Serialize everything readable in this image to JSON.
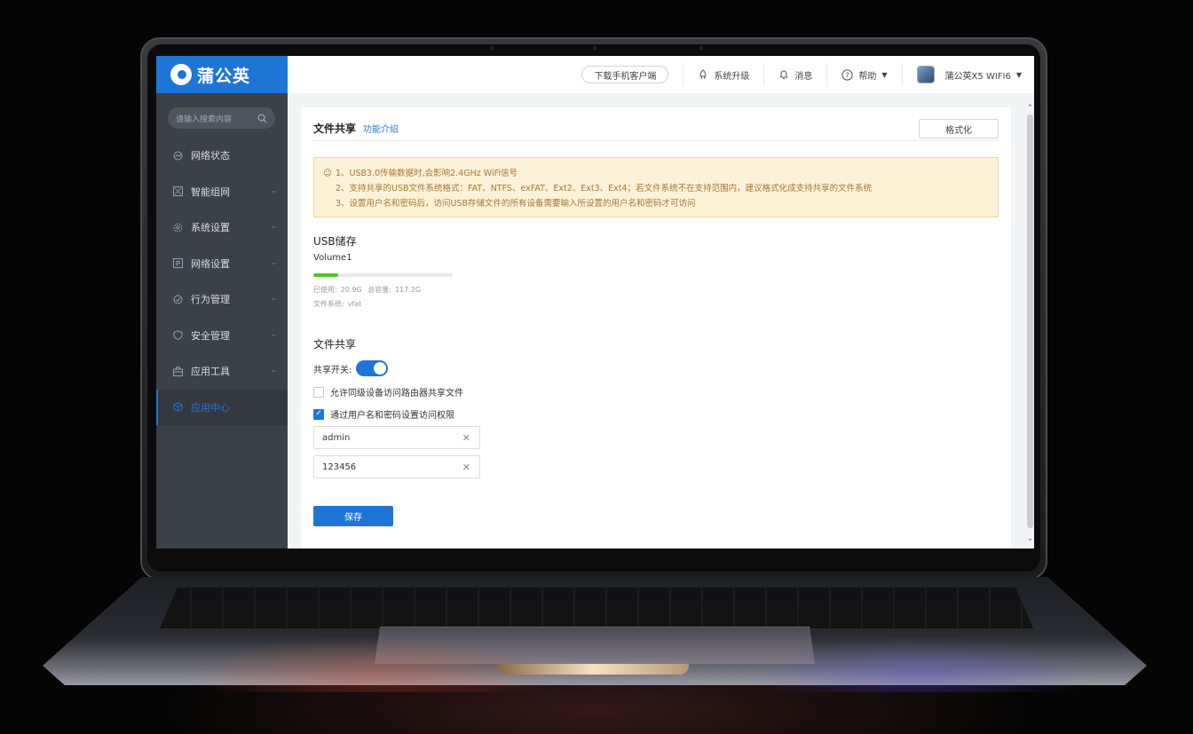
{
  "app": {
    "logo_text": "蒲公英"
  },
  "sidebar": {
    "search_placeholder": "请输入搜索内容",
    "items": [
      {
        "label": "网络状态",
        "icon": "network-status-icon",
        "has_arrow": false
      },
      {
        "label": "智能组网",
        "icon": "smart-network-icon",
        "has_arrow": true
      },
      {
        "label": "系统设置",
        "icon": "gear-icon",
        "has_arrow": true
      },
      {
        "label": "网络设置",
        "icon": "network-settings-icon",
        "has_arrow": true
      },
      {
        "label": "行为管理",
        "icon": "behavior-icon",
        "has_arrow": true
      },
      {
        "label": "安全管理",
        "icon": "shield-icon",
        "has_arrow": true
      },
      {
        "label": "应用工具",
        "icon": "toolbox-icon",
        "has_arrow": true
      },
      {
        "label": "应用中心",
        "icon": "cube-icon",
        "has_arrow": false,
        "active": true
      }
    ]
  },
  "topbar": {
    "download_label": "下载手机客户端",
    "upgrade_label": "系统升级",
    "messages_label": "消息",
    "help_label": "帮助",
    "device_label": "蒲公英X5 WIFI6"
  },
  "page": {
    "title": "文件共享",
    "intro_link": "功能介绍",
    "format_button": "格式化",
    "notices": [
      "1、USB3.0传输数据时,会影响2.4GHz WiFi信号",
      "2、支持共享的USB文件系统格式：FAT、NTFS、exFAT、Ext2、Ext3、Ext4；若文件系统不在支持范围内，建议格式化成支持共享的文件系统",
      "3、设置用户名和密码后，访问USB存储文件的所有设备需要输入所设置的用户名和密码才可访问"
    ],
    "usb_section_title": "USB储存",
    "volume": {
      "name": "Volume1",
      "used_label": "已使用:",
      "used_value": "20.9G",
      "total_label": "总容量:",
      "total_value": "117.2G",
      "fs_label": "文件系统:",
      "fs_value": "vfat",
      "usage_fraction": 0.178
    },
    "share_section_title": "文件共享",
    "share_switch_label": "共享开关:",
    "share_switch_on": true,
    "allow_peer_label": "允许同级设备访问路由器共享文件",
    "allow_peer_checked": false,
    "auth_label": "通过用户名和密码设置访问权限",
    "auth_checked": true,
    "username_value": "admin",
    "password_value": "123456",
    "save_button": "保存"
  },
  "colors": {
    "brand": "#1f75d6",
    "sidebar_bg": "#3c4148",
    "notice_bg": "#fcf2d8",
    "notice_text": "#a77530",
    "usage_bar": "#52c41a"
  }
}
